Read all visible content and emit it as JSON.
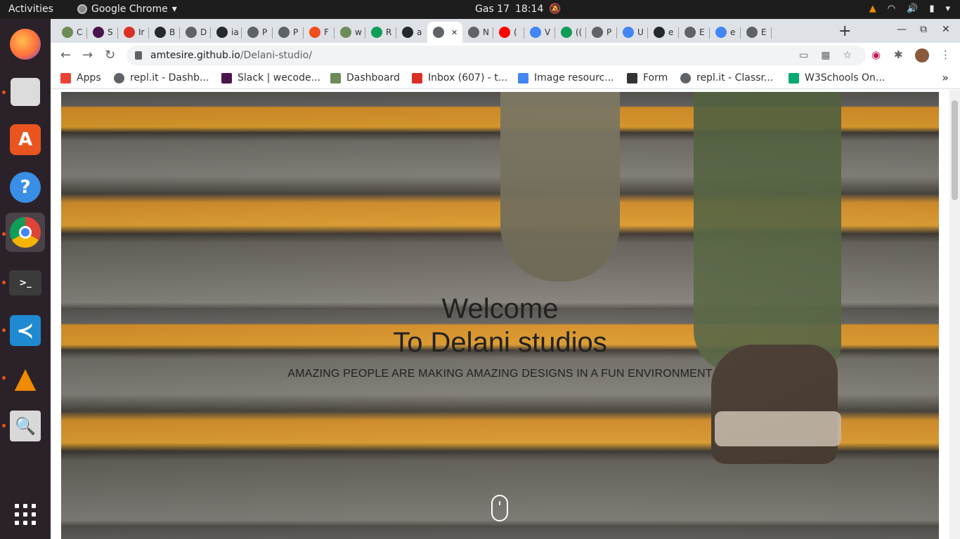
{
  "topbar": {
    "activities": "Activities",
    "app_name": "Google Chrome",
    "date": "Gas 17",
    "time": "18:14"
  },
  "dock": {
    "items": [
      "firefox-icon",
      "files-icon",
      "software-icon",
      "help-icon",
      "chrome-icon",
      "terminal-icon",
      "vscode-icon",
      "vlc-icon",
      "magnifier-icon",
      "app-grid-icon"
    ]
  },
  "tabs": [
    {
      "label": "C",
      "favicon": "plant-icon",
      "color": "#6d8c5a"
    },
    {
      "label": "S",
      "favicon": "slack-icon",
      "color": "#4a154b"
    },
    {
      "label": "Ir",
      "favicon": "gmail-icon",
      "color": "#d93025"
    },
    {
      "label": "B",
      "favicon": "github-icon",
      "color": "#24292e"
    },
    {
      "label": "D",
      "favicon": "globe-icon",
      "color": "#5f6368"
    },
    {
      "label": "ia",
      "favicon": "github-icon",
      "color": "#24292e"
    },
    {
      "label": "P",
      "favicon": "globe-icon",
      "color": "#5f6368"
    },
    {
      "label": "P",
      "favicon": "globe-icon",
      "color": "#5f6368"
    },
    {
      "label": "F",
      "favicon": "figma-icon",
      "color": "#f24e1e"
    },
    {
      "label": "w",
      "favicon": "plant-icon",
      "color": "#6d8c5a"
    },
    {
      "label": "R",
      "favicon": "sheets-icon",
      "color": "#0f9d58"
    },
    {
      "label": "a",
      "favicon": "github-icon",
      "color": "#24292e"
    },
    {
      "label": "",
      "favicon": "globe-icon",
      "color": "#5f6368",
      "active": true
    },
    {
      "label": "N",
      "favicon": "globe-icon",
      "color": "#5f6368"
    },
    {
      "label": "(",
      "favicon": "youtube-icon",
      "color": "#ff0000"
    },
    {
      "label": "V",
      "favicon": "diamond-icon",
      "color": "#4285f4"
    },
    {
      "label": "((",
      "favicon": "badge-icon",
      "color": "#0f9d58"
    },
    {
      "label": "P",
      "favicon": "globe-icon",
      "color": "#5f6368"
    },
    {
      "label": "U",
      "favicon": "docs-icon",
      "color": "#4285f4"
    },
    {
      "label": "e",
      "favicon": "github-icon",
      "color": "#24292e"
    },
    {
      "label": "E",
      "favicon": "globe-icon",
      "color": "#5f6368"
    },
    {
      "label": "e",
      "favicon": "google-icon",
      "color": "#4285f4"
    },
    {
      "label": "E",
      "favicon": "globe-icon",
      "color": "#5f6368"
    }
  ],
  "url": {
    "host": "amtesire.github.io",
    "path": "/Delani-studio/"
  },
  "bookmarks": [
    {
      "label": "Apps",
      "icon": "apps-grid-icon"
    },
    {
      "label": "repl.it - Dashb...",
      "icon": "replit-icon"
    },
    {
      "label": "Slack | wecode...",
      "icon": "slack-icon"
    },
    {
      "label": "Dashboard",
      "icon": "plant-icon"
    },
    {
      "label": "Inbox (607) - t...",
      "icon": "gmail-icon"
    },
    {
      "label": "Image resourc...",
      "icon": "docs-icon"
    },
    {
      "label": "Form",
      "icon": "form-icon"
    },
    {
      "label": "repl.it - Classr...",
      "icon": "replit-icon"
    },
    {
      "label": "W3Schools On...",
      "icon": "w3schools-icon"
    }
  ],
  "hero": {
    "line1": "Welcome",
    "line2": "To Delani studios",
    "tagline": "AMAZING PEOPLE ARE MAKING AMAZING DESIGNS IN A FUN ENVIRONMENT"
  }
}
